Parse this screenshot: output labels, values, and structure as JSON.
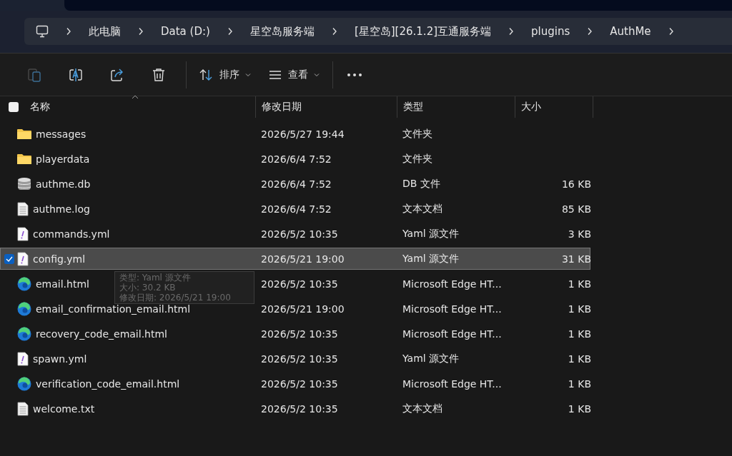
{
  "breadcrumb": {
    "items": [
      {
        "label": "此电脑"
      },
      {
        "label": "Data (D:)"
      },
      {
        "label": "星空岛服务端"
      },
      {
        "label": "[星空岛][26.1.2]互通服务端"
      },
      {
        "label": "plugins"
      },
      {
        "label": "AuthMe"
      }
    ]
  },
  "toolbar": {
    "buttons": [
      {
        "kind": "paste",
        "disabled": true
      },
      {
        "kind": "rename",
        "disabled": false
      },
      {
        "kind": "share",
        "disabled": false
      },
      {
        "kind": "delete",
        "disabled": false
      },
      {
        "kind": "sort",
        "label": "排序",
        "disabled": false
      },
      {
        "kind": "view",
        "label": "查看",
        "disabled": false
      },
      {
        "kind": "more",
        "disabled": false
      }
    ]
  },
  "columns": [
    {
      "label": "名称",
      "sorted": true
    },
    {
      "label": "修改日期",
      "sorted": false
    },
    {
      "label": "类型",
      "sorted": false
    },
    {
      "label": "大小",
      "sorted": false
    }
  ],
  "select_all": {
    "checked": false
  },
  "rows": [
    {
      "kind": "folder",
      "name": "messages",
      "date": "2026/5/27 19:44",
      "type": "文件夹",
      "size": "",
      "selected": false
    },
    {
      "kind": "folder",
      "name": "playerdata",
      "date": "2026/6/4 7:52",
      "type": "文件夹",
      "size": "",
      "selected": false
    },
    {
      "kind": "database",
      "name": "authme.db",
      "date": "2026/6/4 7:52",
      "type": "DB 文件",
      "size": "16 KB",
      "selected": false
    },
    {
      "kind": "text",
      "name": "authme.log",
      "date": "2026/6/4 7:52",
      "type": "文本文档",
      "size": "85 KB",
      "selected": false
    },
    {
      "kind": "yaml",
      "name": "commands.yml",
      "date": "2026/5/2 10:35",
      "type": "Yaml 源文件",
      "size": "3 KB",
      "selected": false
    },
    {
      "kind": "yaml",
      "name": "config.yml",
      "date": "2026/5/21 19:00",
      "type": "Yaml 源文件",
      "size": "31 KB",
      "selected": true
    },
    {
      "kind": "edge",
      "name": "email.html",
      "date": "2026/5/2 10:35",
      "type": "Microsoft Edge HT...",
      "size": "1 KB",
      "selected": false
    },
    {
      "kind": "edge",
      "name": "email_confirmation_email.html",
      "date": "2026/5/21 19:00",
      "type": "Microsoft Edge HT...",
      "size": "1 KB",
      "selected": false
    },
    {
      "kind": "edge",
      "name": "recovery_code_email.html",
      "date": "2026/5/2 10:35",
      "type": "Microsoft Edge HT...",
      "size": "1 KB",
      "selected": false
    },
    {
      "kind": "yaml",
      "name": "spawn.yml",
      "date": "2026/5/2 10:35",
      "type": "Yaml 源文件",
      "size": "1 KB",
      "selected": false
    },
    {
      "kind": "edge",
      "name": "verification_code_email.html",
      "date": "2026/5/2 10:35",
      "type": "Microsoft Edge HT...",
      "size": "1 KB",
      "selected": false
    },
    {
      "kind": "text",
      "name": "welcome.txt",
      "date": "2026/5/2 10:35",
      "type": "文本文档",
      "size": "1 KB",
      "selected": false
    }
  ],
  "tooltip": {
    "lines": [
      "类型: Yaml 源文件",
      "大小: 30.2 KB",
      "修改日期: 2026/5/21 19:00"
    ]
  }
}
